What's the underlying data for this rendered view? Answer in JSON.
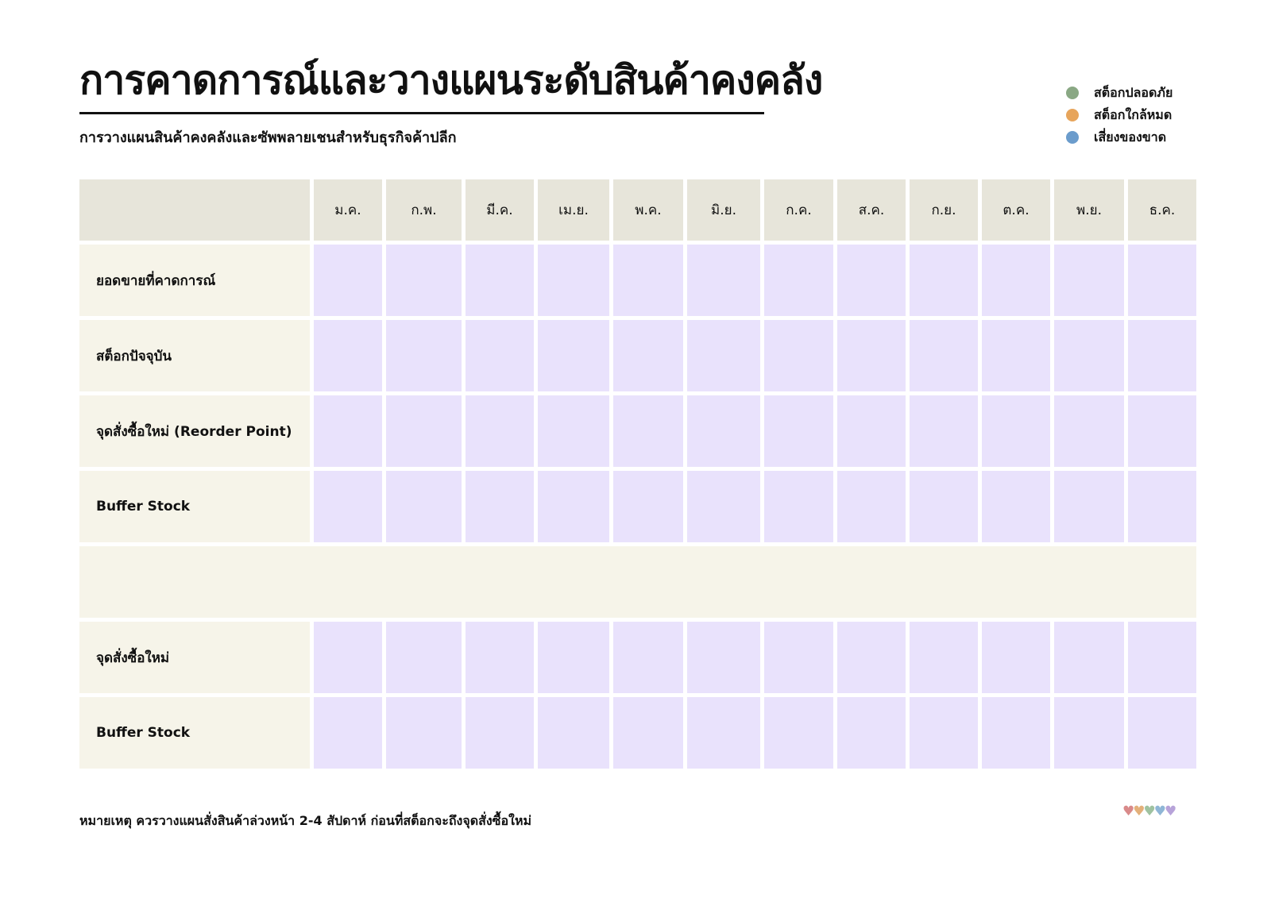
{
  "title": "การคาดการณ์และวางแผนระดับสินค้าคงคลัง",
  "subtitle": "การวางแผนสินค้าคงคลังและซัพพลายเชนสำหรับธุรกิจค้าปลีก",
  "legend": [
    {
      "label": "สต็อกปลอดภัย",
      "color": "#8aa884"
    },
    {
      "label": "สต็อกใกล้หมด",
      "color": "#e7a55c"
    },
    {
      "label": "เสี่ยงของขาด",
      "color": "#6b9ccc"
    }
  ],
  "months": [
    "ม.ค.",
    "ก.พ.",
    "มี.ค.",
    "เม.ย.",
    "พ.ค.",
    "มิ.ย.",
    "ก.ค.",
    "ส.ค.",
    "ก.ย.",
    "ต.ค.",
    "พ.ย.",
    "ธ.ค."
  ],
  "rows": {
    "r0": "ยอดขายที่คาดการณ์",
    "r1": "สต็อกปัจจุบัน",
    "r2": "จุดสั่งซื้อใหม่ (Reorder Point)",
    "r3": "Buffer Stock",
    "r4": "จุดสั่งซื้อใหม่",
    "r5": "Buffer Stock"
  },
  "note": "หมายเหตุ ควรวางแผนสั่งสินค้าล่วงหน้า 2-4 สัปดาห์ ก่อนที่สต็อกจะถึงจุดสั่งซื้อใหม่",
  "hearts": [
    "#d98a8a",
    "#e3b07a",
    "#9fc2a0",
    "#8fb6d6",
    "#b7a3d9"
  ],
  "colors": {
    "header_bg": "#e7e5da",
    "label_bg": "#f6f4e9",
    "cell_bg": "#e9e2fc"
  }
}
